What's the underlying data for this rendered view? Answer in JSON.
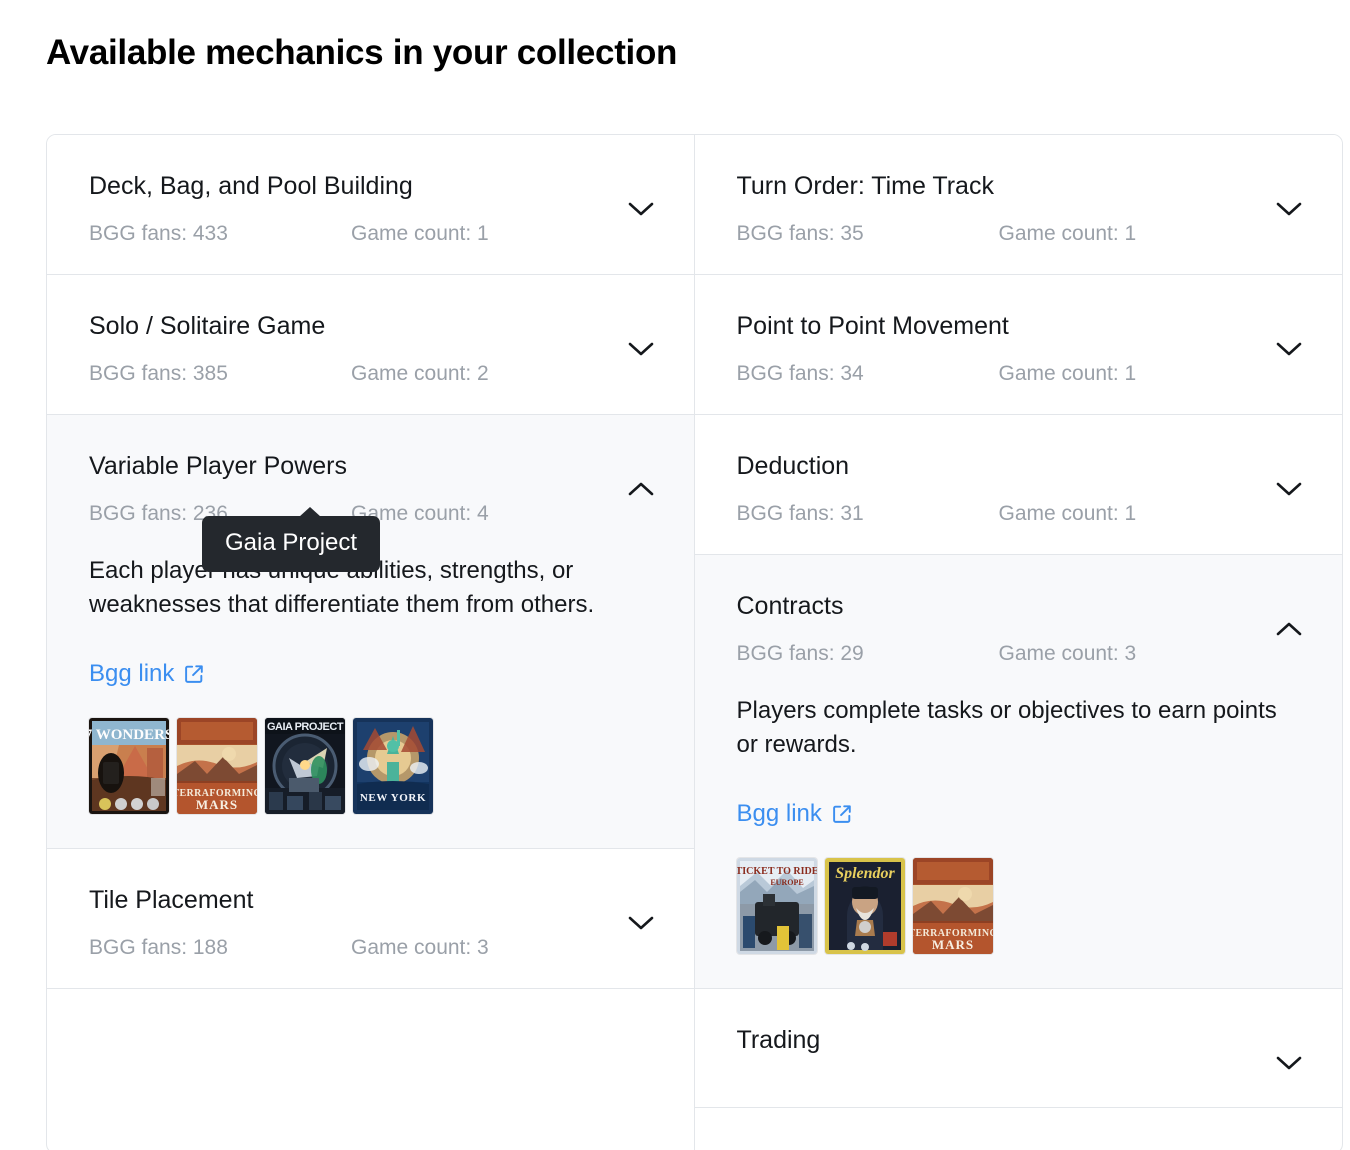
{
  "page": {
    "title": "Available mechanics in your collection"
  },
  "labels": {
    "fans_prefix": "BGG fans: ",
    "count_prefix": "Game count: ",
    "bgg_link": "Bgg link",
    "chevron_down_icon": "chevron-down-icon",
    "chevron_up_icon": "chevron-up-icon",
    "external_link_icon": "external-link-icon"
  },
  "colors": {
    "accent_link": "#3b8ef0",
    "panel_border": "#e3e6ea",
    "expanded_bg": "#f8f9fb",
    "muted_text": "#9aa0a8",
    "title_text": "#15181c",
    "tooltip_bg": "#24282d"
  },
  "tooltip": {
    "visible": true,
    "text": "Gaia Project"
  },
  "left_column": [
    {
      "name": "Deck, Bag, and Pool Building",
      "fans": "BGG fans: 433",
      "count": "Game count: 1",
      "expanded": false,
      "chevron": "chevron-down-icon"
    },
    {
      "name": "Solo / Solitaire Game",
      "fans": "BGG fans: 385",
      "count": "Game count: 2",
      "expanded": false,
      "chevron": "chevron-down-icon"
    },
    {
      "name": "Variable Player Powers",
      "fans": "BGG fans: 236",
      "count": "Game count: 4",
      "expanded": true,
      "chevron": "chevron-up-icon",
      "description": "Each player has unique abilities, strengths, or weaknesses that differentiate them from others.",
      "link_label": "Bgg link",
      "games": [
        "7 Wonders",
        "Terraforming Mars",
        "Gaia Project",
        "New York"
      ]
    },
    {
      "name": "Tile Placement",
      "fans": "BGG fans: 188",
      "count": "Game count: 3",
      "expanded": false,
      "chevron": "chevron-down-icon"
    }
  ],
  "right_column": [
    {
      "name": "Turn Order: Time Track",
      "fans": "BGG fans: 35",
      "count": "Game count: 1",
      "expanded": false,
      "chevron": "chevron-down-icon"
    },
    {
      "name": "Point to Point Movement",
      "fans": "BGG fans: 34",
      "count": "Game count: 1",
      "expanded": false,
      "chevron": "chevron-down-icon"
    },
    {
      "name": "Deduction",
      "fans": "BGG fans: 31",
      "count": "Game count: 1",
      "expanded": false,
      "chevron": "chevron-down-icon"
    },
    {
      "name": "Contracts",
      "fans": "BGG fans: 29",
      "count": "Game count: 3",
      "expanded": true,
      "chevron": "chevron-up-icon",
      "description": "Players complete tasks or objectives to earn points or rewards.",
      "link_label": "Bgg link",
      "games": [
        "Ticket to Ride Europe",
        "Splendor",
        "Terraforming Mars"
      ]
    },
    {
      "name": "Trading",
      "fans": "",
      "count": "",
      "expanded": false,
      "chevron": "chevron-down-icon",
      "clipped": true
    }
  ]
}
